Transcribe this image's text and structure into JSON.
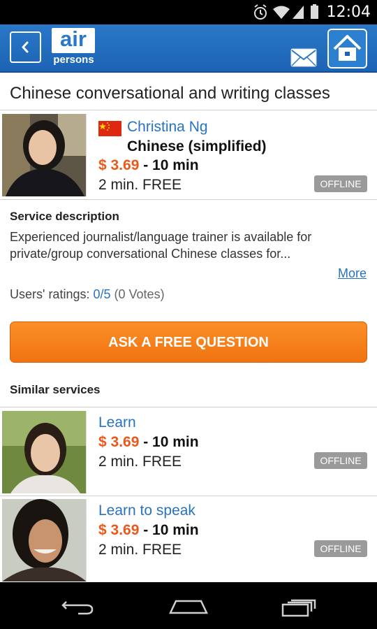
{
  "status_bar": {
    "time": "12:04",
    "icons": [
      "alarm-icon",
      "wifi-icon",
      "signal-icon",
      "battery-icon"
    ]
  },
  "header": {
    "logo_top": "air",
    "logo_bottom": "persons",
    "icons": [
      "back-arrow-icon",
      "mail-icon",
      "home-icon"
    ],
    "brand_color": "#1d63b3"
  },
  "page": {
    "title": "Chinese conversational and writing classes"
  },
  "expert": {
    "name": "Christina Ng",
    "language": "Chinese (simplified)",
    "price": "$ 3.69",
    "duration": "- 10 min",
    "free": "2 min. FREE",
    "status": "OFFLINE",
    "flag": "china-flag-icon"
  },
  "description": {
    "label": "Service description",
    "text": "Experienced journalist/language trainer is available for private/group conversational Chinese classes for...",
    "more": "More"
  },
  "ratings": {
    "label": "Users' ratings:",
    "score": "0/5",
    "votes": "(0 Votes)"
  },
  "ask_button": "ASK A FREE QUESTION",
  "similar": {
    "label": "Similar services",
    "items": [
      {
        "title": "Learn",
        "price": "$ 3.69",
        "duration": "- 10 min",
        "free": "2 min. FREE",
        "status": "OFFLINE"
      },
      {
        "title": "Learn to speak",
        "price": "$ 3.69",
        "duration": "- 10 min",
        "free": "2 min. FREE",
        "status": "OFFLINE"
      }
    ]
  },
  "nav_bar": {
    "icons": [
      "nav-back-icon",
      "nav-home-icon",
      "nav-recents-icon"
    ]
  },
  "colors": {
    "accent_orange": "#f07411",
    "price_orange": "#e9591a",
    "link_blue": "#2773c0",
    "offline_gray": "#9a9a9a"
  }
}
